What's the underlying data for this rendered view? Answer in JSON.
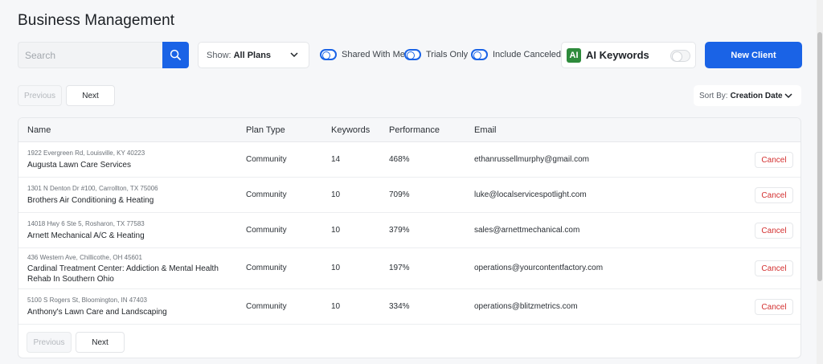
{
  "page": {
    "title": "Business Management"
  },
  "toolbar": {
    "search_placeholder": "Search",
    "show_label": "Show:",
    "show_value": "All Plans",
    "toggles": [
      "Shared With Me",
      "Trials Only",
      "Include Canceled"
    ],
    "ai_badge": "AI",
    "ai_label": "AI Keywords",
    "new_client_label": "New Client",
    "accent_color": "#1a63e6"
  },
  "pager_top": {
    "previous": "Previous",
    "next": "Next"
  },
  "pager_bottom": {
    "previous": "Previous",
    "next": "Next"
  },
  "sort": {
    "label": "Sort By:",
    "value": "Creation Date"
  },
  "table": {
    "columns": [
      "Name",
      "Plan Type",
      "Keywords",
      "Performance",
      "Email"
    ],
    "rows": [
      {
        "address": "1922 Evergreen Rd, Louisville, KY 40223",
        "name": "Augusta Lawn Care Services",
        "plan": "Community",
        "keywords": "14",
        "performance": "468%",
        "email": "ethanrussellmurphy@gmail.com",
        "action": "Cancel"
      },
      {
        "address": "1301 N Denton Dr #100, Carrollton, TX 75006",
        "name": "Brothers Air Conditioning & Heating",
        "plan": "Community",
        "keywords": "10",
        "performance": "709%",
        "email": "luke@localservicespotlight.com",
        "action": "Cancel"
      },
      {
        "address": "14018 Hwy 6 Ste 5, Rosharon, TX 77583",
        "name": "Arnett Mechanical A/C & Heating",
        "plan": "Community",
        "keywords": "10",
        "performance": "379%",
        "email": "sales@arnettmechanical.com",
        "action": "Cancel"
      },
      {
        "address": "436 Western Ave, Chillicothe, OH 45601",
        "name": "Cardinal Treatment Center: Addiction & Mental Health Rehab In Southern Ohio",
        "plan": "Community",
        "keywords": "10",
        "performance": "197%",
        "email": "operations@yourcontentfactory.com",
        "action": "Cancel"
      },
      {
        "address": "5100 S Rogers St, Bloomington, IN 47403",
        "name": "Anthony's Lawn Care and Landscaping",
        "plan": "Community",
        "keywords": "10",
        "performance": "334%",
        "email": "operations@blitzmetrics.com",
        "action": "Cancel"
      }
    ]
  }
}
